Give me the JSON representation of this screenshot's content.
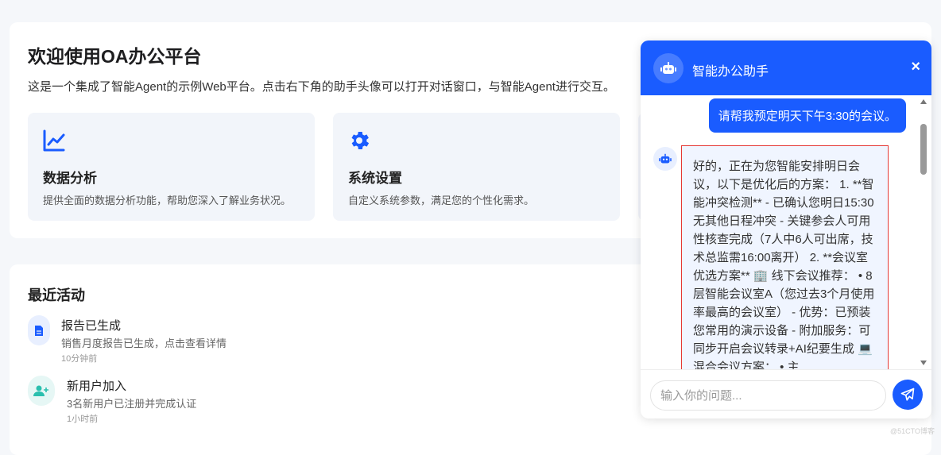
{
  "page": {
    "title": "欢迎使用OA办公平台",
    "description": "这是一个集成了智能Agent的示例Web平台。点击右下角的助手头像可以打开对话窗口，与智能Agent进行交互。"
  },
  "features": [
    {
      "icon": "chart-line-icon",
      "title": "数据分析",
      "desc": "提供全面的数据分析功能，帮助您深入了解业务状况。"
    },
    {
      "icon": "gear-icon",
      "title": "系统设置",
      "desc": "自定义系统参数，满足您的个性化需求。"
    }
  ],
  "activity": {
    "title": "最近活动",
    "items": [
      {
        "icon": "document-icon",
        "title": "报告已生成",
        "desc": "销售月度报告已生成，点击查看详情",
        "time": "10分钟前"
      },
      {
        "icon": "user-plus-icon",
        "title": "新用户加入",
        "desc": "3名新用户已注册并完成认证",
        "time": "1小时前"
      }
    ]
  },
  "chat": {
    "title": "智能办公助手",
    "close": "×",
    "user_message": "请帮我预定明天下午3:30的会议。",
    "bot_message": "好的，正在为您智能安排明日会议，以下是优化后的方案： 1. **智能冲突检测** - 已确认您明日15:30无其他日程冲突 - 关键参会人可用性核查完成（7人中6人可出席，技术总监需16:00离开） 2. **会议室优选方案** 🏢 线下会议推荐： • 8层智能会议室A（您过去3个月使用率最高的会议室） - 优势：已预装您常用的演示设备 - 附加服务：可同步开启会议转录+AI纪要生成 💻 混合会议方案： • 主",
    "input_placeholder": "输入你的问题...",
    "input_value": ""
  },
  "watermark": "@51CTO博客",
  "colors": {
    "accent": "#1a5cff",
    "highlight_border": "#e53935"
  }
}
